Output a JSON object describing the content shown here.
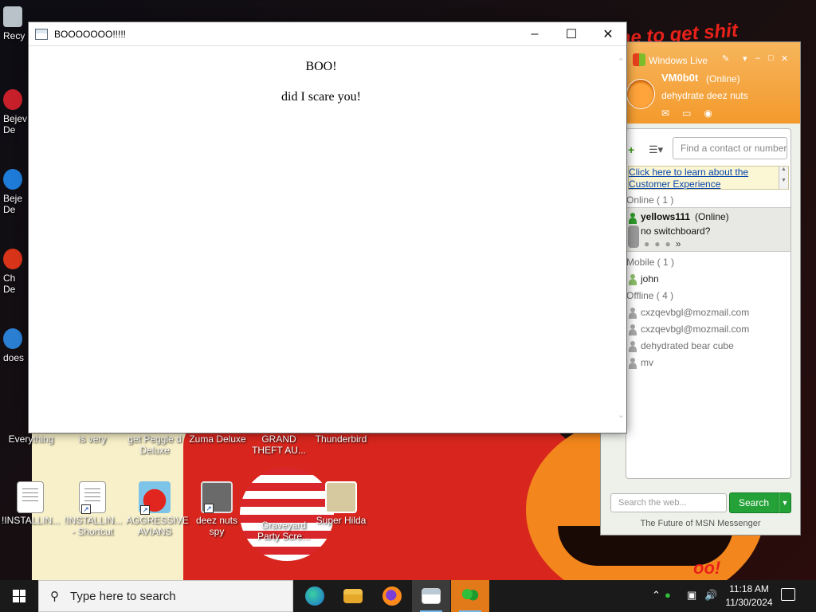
{
  "popup": {
    "title": "BOOOOOOO!!!!!",
    "heading": "BOO!",
    "message": "did I scare you!"
  },
  "desktop_icons": [
    {
      "label": "Recy",
      "name": "recycle-bin"
    },
    {
      "label": "Bejev\nDe",
      "name": "bejeweled-1"
    },
    {
      "label": "Beje\nDe",
      "name": "bejeweled-2"
    },
    {
      "label": "Ch\nDe",
      "name": "chuzzle"
    },
    {
      "label": "does",
      "name": "does"
    },
    {
      "label": "Everything",
      "name": "everything"
    },
    {
      "label": "is very",
      "name": "is-very"
    },
    {
      "label": "get Peggle d\nDeluxe",
      "name": "peggle"
    },
    {
      "label": "Zuma Deluxe",
      "name": "zuma"
    },
    {
      "label": "GRAND\nTHEFT AU...",
      "name": "gta"
    },
    {
      "label": "Thunderbird",
      "name": "thunderbird"
    },
    {
      "label": "!INSTALLIN...",
      "name": "installing"
    },
    {
      "label": "!INSTALLIN...\n- Shortcut",
      "name": "installing-shortcut"
    },
    {
      "label": "AGGRESSIVE\nAVIANS",
      "name": "aggressive-avians"
    },
    {
      "label": "deez nuts spy",
      "name": "deez-nuts-spy"
    },
    {
      "label": "Graveyard\nParty Scre...",
      "name": "graveyard"
    },
    {
      "label": "Super Hilda",
      "name": "super-hilda"
    }
  ],
  "wallpaper": {
    "top_text": "me to get shit",
    "bottom_text": "oo!"
  },
  "messenger": {
    "brand": "Windows Live",
    "username": "VM0b0t",
    "status": "(Online)",
    "personal_message": "dehydrate deez nuts",
    "find_placeholder": "Find a contact or number",
    "banner_text": "Click here to learn about the Customer Experience",
    "groups": {
      "online": "Online ( 1 )",
      "mobile": "Mobile ( 1 )",
      "offline": "Offline ( 4 )"
    },
    "online_contact": {
      "name": "yellows111",
      "status": "(Online)",
      "message": "no switchboard?"
    },
    "mobile_contact": "john",
    "offline_contacts": [
      "cxzqevbgl@mozmail.com",
      "cxzqevbgl@mozmail.com",
      "dehydrated bear cube",
      "mv"
    ],
    "web_search_placeholder": "Search the web...",
    "search_button": "Search",
    "footer": "The Future of MSN Messenger"
  },
  "taskbar": {
    "search_placeholder": "Type here to search",
    "time": "11:18 AM",
    "date": "11/30/2024"
  },
  "colors": {
    "msn_header": "#f39a2c",
    "search_green": "#24a238",
    "link_blue": "#0645ad"
  }
}
